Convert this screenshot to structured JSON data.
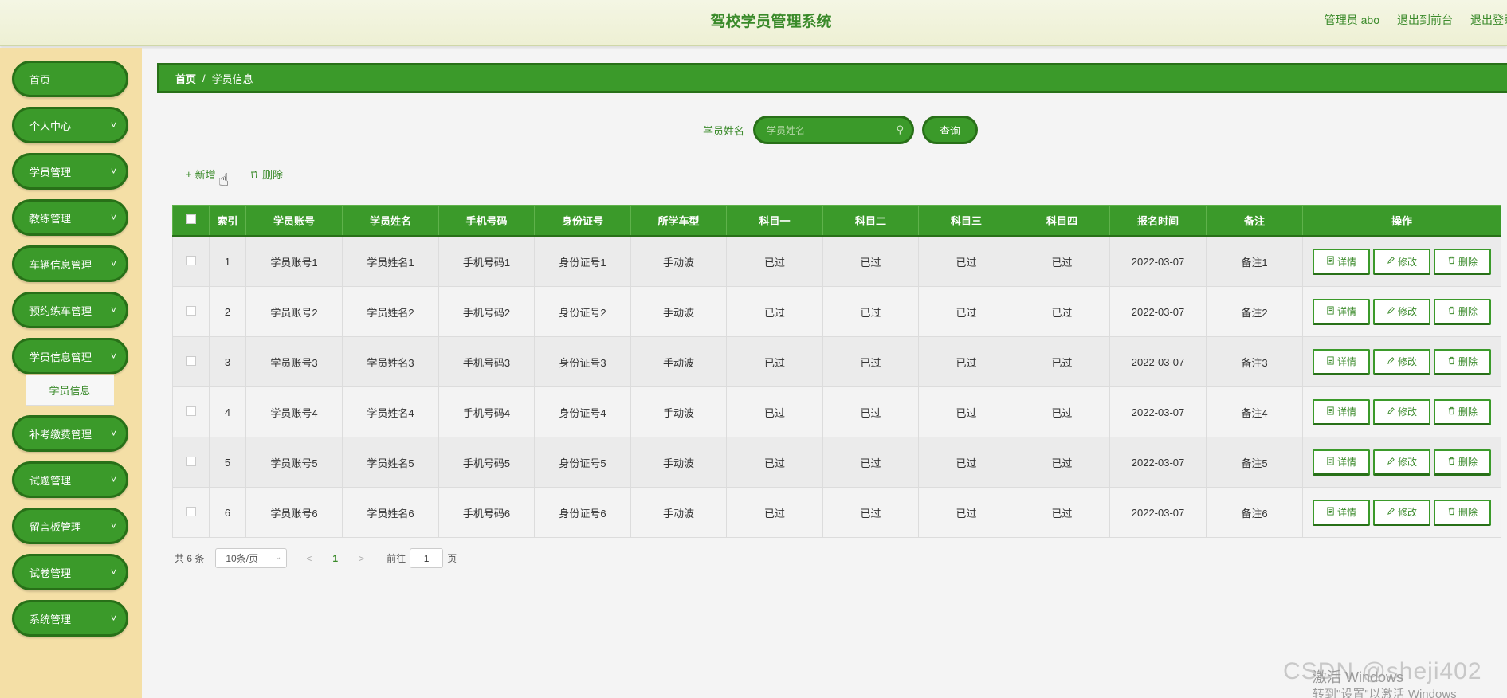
{
  "header": {
    "title": "驾校学员管理系统",
    "admin": "管理员 abo",
    "to_front": "退出到前台",
    "logout": "退出登录"
  },
  "sidebar": {
    "items": [
      {
        "label": "首页",
        "has_chevron": false
      },
      {
        "label": "个人中心",
        "has_chevron": true
      },
      {
        "label": "学员管理",
        "has_chevron": true
      },
      {
        "label": "教练管理",
        "has_chevron": true
      },
      {
        "label": "车辆信息管理",
        "has_chevron": true
      },
      {
        "label": "预约练车管理",
        "has_chevron": true
      },
      {
        "label": "学员信息管理",
        "has_chevron": true,
        "expanded": true
      },
      {
        "label": "补考缴费管理",
        "has_chevron": true
      },
      {
        "label": "试题管理",
        "has_chevron": true
      },
      {
        "label": "留言板管理",
        "has_chevron": true
      },
      {
        "label": "试卷管理",
        "has_chevron": true
      },
      {
        "label": "系统管理",
        "has_chevron": true
      }
    ],
    "submenu_label": "学员信息"
  },
  "breadcrumb": {
    "home": "首页",
    "separator": "/",
    "current": "学员信息"
  },
  "search": {
    "label": "学员姓名",
    "placeholder": "学员姓名",
    "button": "查询"
  },
  "actions": {
    "add": "新增",
    "delete": "删除"
  },
  "table": {
    "columns": [
      "索引",
      "学员账号",
      "学员姓名",
      "手机号码",
      "身份证号",
      "所学车型",
      "科目一",
      "科目二",
      "科目三",
      "科目四",
      "报名时间",
      "备注",
      "操作"
    ],
    "rows": [
      [
        "1",
        "学员账号1",
        "学员姓名1",
        "手机号码1",
        "身份证号1",
        "手动波",
        "已过",
        "已过",
        "已过",
        "已过",
        "2022-03-07",
        "备注1"
      ],
      [
        "2",
        "学员账号2",
        "学员姓名2",
        "手机号码2",
        "身份证号2",
        "手动波",
        "已过",
        "已过",
        "已过",
        "已过",
        "2022-03-07",
        "备注2"
      ],
      [
        "3",
        "学员账号3",
        "学员姓名3",
        "手机号码3",
        "身份证号3",
        "手动波",
        "已过",
        "已过",
        "已过",
        "已过",
        "2022-03-07",
        "备注3"
      ],
      [
        "4",
        "学员账号4",
        "学员姓名4",
        "手机号码4",
        "身份证号4",
        "手动波",
        "已过",
        "已过",
        "已过",
        "已过",
        "2022-03-07",
        "备注4"
      ],
      [
        "5",
        "学员账号5",
        "学员姓名5",
        "手机号码5",
        "身份证号5",
        "手动波",
        "已过",
        "已过",
        "已过",
        "已过",
        "2022-03-07",
        "备注5"
      ],
      [
        "6",
        "学员账号6",
        "学员姓名6",
        "手机号码6",
        "身份证号6",
        "手动波",
        "已过",
        "已过",
        "已过",
        "已过",
        "2022-03-07",
        "备注6"
      ]
    ],
    "row_buttons": {
      "detail": "详情",
      "edit": "修改",
      "delete": "删除"
    }
  },
  "pagination": {
    "total": "共 6 条",
    "page_size": "10条/页",
    "current_page": "1",
    "goto_label": "前往",
    "goto_value": "1",
    "page_unit": "页"
  },
  "watermark": {
    "csdn": "CSDN @sheji402",
    "activate": "激活 Windows",
    "activate_hint": "转到\"设置\"以激活 Windows"
  },
  "colors": {
    "primary": "#3b9a2a",
    "primary_dark": "#287018",
    "sidebar_bg": "#f4dfa6",
    "header_bg": "#f4f6e4"
  }
}
